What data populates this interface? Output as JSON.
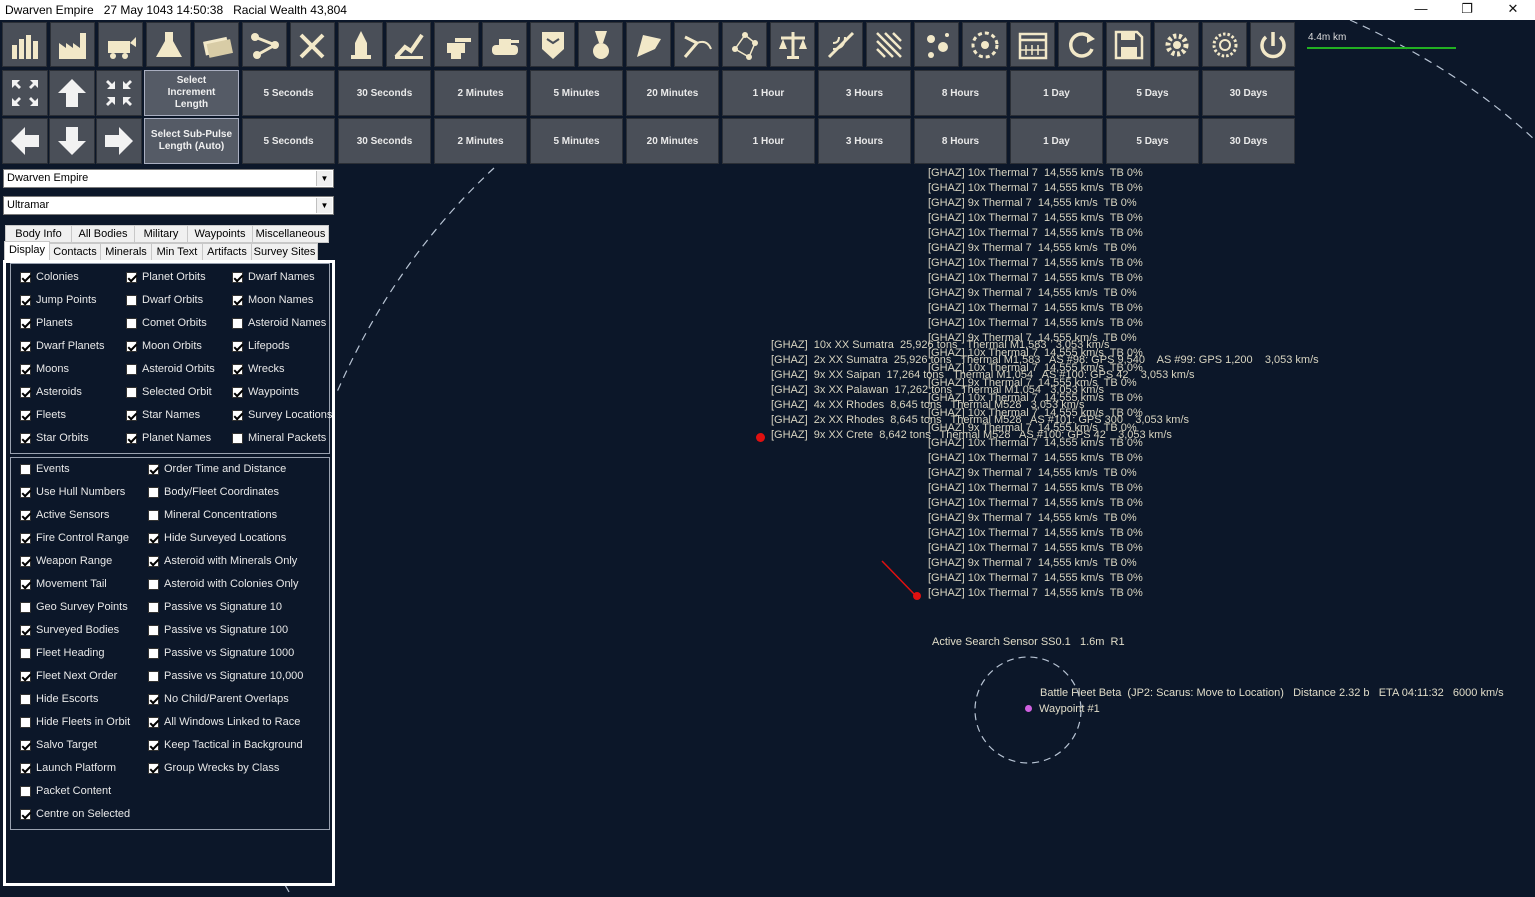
{
  "window": {
    "title": "Dwarven Empire   27 May 1043 14:50:38   Racial Wealth 43,804",
    "minimize": "—",
    "restore": "❐",
    "close": "✕"
  },
  "toolbar_icons": [
    "economics-icon",
    "industry-icon",
    "mining-icon",
    "research-icon",
    "wealth-icon",
    "jump-network-icon",
    "ship-design-icon",
    "shipyard-icon",
    "ground-forces-icon",
    "turret-icon",
    "tank-icon",
    "commanders-icon",
    "medals-icon",
    "intelligence-icon",
    "system-view-icon",
    "galactic-map-icon",
    "diplomacy-icon",
    "sensor-icon",
    "surveying-icon",
    "events-icon",
    "astronomy-icon",
    "calendar-icon",
    "refresh-icon",
    "save-icon",
    "settings-icon",
    "gear-alt-icon",
    "power-icon"
  ],
  "scale": {
    "label": "4.4m km",
    "color": "#22b022"
  },
  "time": {
    "increment_label": "Select Increment Length",
    "subpulse_label": "Select Sub-Pulse Length (Auto)",
    "increments": [
      "5 Seconds",
      "30 Seconds",
      "2 Minutes",
      "5 Minutes",
      "20 Minutes",
      "1 Hour",
      "3 Hours",
      "8 Hours",
      "1 Day",
      "5 Days",
      "30 Days"
    ],
    "subpulses": [
      "5 Seconds",
      "30 Seconds",
      "2 Minutes",
      "5 Minutes",
      "20 Minutes",
      "1 Hour",
      "3 Hours",
      "8 Hours",
      "1 Day",
      "5 Days",
      "30 Days"
    ]
  },
  "selectors": {
    "race": "Dwarven Empire",
    "system": "Ultramar"
  },
  "tabs_row1": [
    "Body Info",
    "All Bodies",
    "Military",
    "Waypoints",
    "Miscellaneous"
  ],
  "tabs_row2": [
    "Display",
    "Contacts",
    "Minerals",
    "Min Text",
    "Artifacts",
    "Survey Sites"
  ],
  "display_top": [
    [
      {
        "label": "Colonies",
        "checked": true
      },
      {
        "label": "Planet Orbits",
        "checked": true
      },
      {
        "label": "Dwarf Names",
        "checked": true
      }
    ],
    [
      {
        "label": "Jump Points",
        "checked": true
      },
      {
        "label": "Dwarf Orbits",
        "checked": false
      },
      {
        "label": "Moon Names",
        "checked": true
      }
    ],
    [
      {
        "label": "Planets",
        "checked": true
      },
      {
        "label": "Comet Orbits",
        "checked": false
      },
      {
        "label": "Asteroid Names",
        "checked": false
      }
    ],
    [
      {
        "label": "Dwarf Planets",
        "checked": true
      },
      {
        "label": "Moon Orbits",
        "checked": true
      },
      {
        "label": "Lifepods",
        "checked": true
      }
    ],
    [
      {
        "label": "Moons",
        "checked": true
      },
      {
        "label": "Asteroid Orbits",
        "checked": false
      },
      {
        "label": "Wrecks",
        "checked": true
      }
    ],
    [
      {
        "label": "Asteroids",
        "checked": true
      },
      {
        "label": "Selected Orbit",
        "checked": false
      },
      {
        "label": "Waypoints",
        "checked": true
      }
    ],
    [
      {
        "label": "Fleets",
        "checked": true
      },
      {
        "label": "Star Names",
        "checked": true
      },
      {
        "label": "Survey Locations",
        "checked": true
      }
    ],
    [
      {
        "label": "Star Orbits",
        "checked": true
      },
      {
        "label": "Planet Names",
        "checked": true
      },
      {
        "label": "Mineral Packets",
        "checked": false
      }
    ]
  ],
  "display_bottom_left": [
    {
      "label": "Events",
      "checked": false
    },
    {
      "label": "Use Hull Numbers",
      "checked": true
    },
    {
      "label": "Active Sensors",
      "checked": true
    },
    {
      "label": "Fire Control Range",
      "checked": true
    },
    {
      "label": "Weapon Range",
      "checked": true
    },
    {
      "label": "Movement Tail",
      "checked": true
    },
    {
      "label": "Geo Survey Points",
      "checked": false
    },
    {
      "label": "Surveyed Bodies",
      "checked": true
    },
    {
      "label": "Fleet Heading",
      "checked": false
    },
    {
      "label": "Fleet Next Order",
      "checked": true
    },
    {
      "label": "Hide Escorts",
      "checked": false
    },
    {
      "label": "Hide Fleets in Orbit",
      "checked": false
    },
    {
      "label": "Salvo Target",
      "checked": true
    },
    {
      "label": "Launch Platform",
      "checked": true
    },
    {
      "label": "Packet Content",
      "checked": false
    },
    {
      "label": "Centre on Selected",
      "checked": true
    }
  ],
  "display_bottom_right": [
    {
      "label": "Order Time and Distance",
      "checked": true
    },
    {
      "label": "Body/Fleet Coordinates",
      "checked": false
    },
    {
      "label": "Mineral Concentrations",
      "checked": false
    },
    {
      "label": "Hide Surveyed Locations",
      "checked": true
    },
    {
      "label": "Asteroid with Minerals Only",
      "checked": true
    },
    {
      "label": "Asteroid with Colonies Only",
      "checked": false
    },
    {
      "label": "Passive vs Signature 10",
      "checked": false
    },
    {
      "label": "Passive vs Signature 100",
      "checked": false
    },
    {
      "label": "Passive vs Signature 1000",
      "checked": false
    },
    {
      "label": "Passive vs Signature 10,000",
      "checked": false
    },
    {
      "label": "No Child/Parent Overlaps",
      "checked": true
    },
    {
      "label": "All Windows Linked to Race",
      "checked": true
    },
    {
      "label": "Keep Tactical in Background",
      "checked": true
    },
    {
      "label": "Group Wrecks by Class",
      "checked": true
    }
  ],
  "map": {
    "salvo_lines": [
      "[GHAZ] 10x Thermal 7  14,555 km/s  TB 0%",
      "[GHAZ] 10x Thermal 7  14,555 km/s  TB 0%",
      "[GHAZ] 9x Thermal 7  14,555 km/s  TB 0%",
      "[GHAZ] 10x Thermal 7  14,555 km/s  TB 0%",
      "[GHAZ] 10x Thermal 7  14,555 km/s  TB 0%",
      "[GHAZ] 9x Thermal 7  14,555 km/s  TB 0%",
      "[GHAZ] 10x Thermal 7  14,555 km/s  TB 0%",
      "[GHAZ] 10x Thermal 7  14,555 km/s  TB 0%",
      "[GHAZ] 9x Thermal 7  14,555 km/s  TB 0%",
      "[GHAZ] 10x Thermal 7  14,555 km/s  TB 0%",
      "[GHAZ] 10x Thermal 7  14,555 km/s  TB 0%",
      "[GHAZ] 9x Thermal 7  14,555 km/s  TB 0%",
      "[GHAZ] 10x Thermal 7  14,555 km/s  TB 0%",
      "[GHAZ] 10x Thermal 7  14,555 km/s  TB 0%",
      "[GHAZ] 9x Thermal 7  14,555 km/s  TB 0%",
      "[GHAZ] 10x Thermal 7  14,555 km/s  TB 0%",
      "[GHAZ] 10x Thermal 7  14,555 km/s  TB 0%",
      "[GHAZ] 9x Thermal 7  14,555 km/s  TB 0%",
      "[GHAZ] 10x Thermal 7  14,555 km/s  TB 0%",
      "[GHAZ] 10x Thermal 7  14,555 km/s  TB 0%",
      "[GHAZ] 9x Thermal 7  14,555 km/s  TB 0%",
      "[GHAZ] 10x Thermal 7  14,555 km/s  TB 0%",
      "[GHAZ] 10x Thermal 7  14,555 km/s  TB 0%",
      "[GHAZ] 9x Thermal 7  14,555 km/s  TB 0%",
      "[GHAZ] 10x Thermal 7  14,555 km/s  TB 0%",
      "[GHAZ] 10x Thermal 7  14,555 km/s  TB 0%",
      "[GHAZ] 9x Thermal 7  14,555 km/s  TB 0%",
      "[GHAZ] 10x Thermal 7  14,555 km/s  TB 0%",
      "[GHAZ] 10x Thermal 7  14,555 km/s  TB 0%"
    ],
    "enemy_fleets": [
      "[GHAZ]  10x XX Sumatra  25,926 tons   Thermal M1,583   3,053 km/s",
      "[GHAZ]  2x XX Sumatra  25,926 tons   Thermal M1,583   AS #98: GPS 9,540    AS #99: GPS 1,200    3,053 km/s",
      "[GHAZ]  9x XX Saipan  17,264 tons   Thermal M1,054   AS #100: GPS 42    3,053 km/s",
      "[GHAZ]  3x XX Palawan  17,262 tons   Thermal M1,054   3,053 km/s",
      "[GHAZ]  4x XX Rhodes  8,645 tons   Thermal M528   3,053 km/s",
      "[GHAZ]  2x XX Rhodes  8,645 tons   Thermal M528   AS #101: GPS 300    3,053 km/s",
      "[GHAZ]  9x XX Crete  8,642 tons   Thermal M528   AS #100: GPS 42    3,053 km/s"
    ],
    "sensor_label": "Active Search Sensor SS0.1   1.6m  R1",
    "fleet_label": "Battle Fleet Beta  (JP2: Scarus: Move to Location)   Distance 2.32 b   ETA 04:11:32   6000 km/s",
    "waypoint_label": "Waypoint #1",
    "colors": {
      "background": "#0c1729",
      "enemy": "#e01010",
      "waypoint": "#d060e0"
    }
  }
}
